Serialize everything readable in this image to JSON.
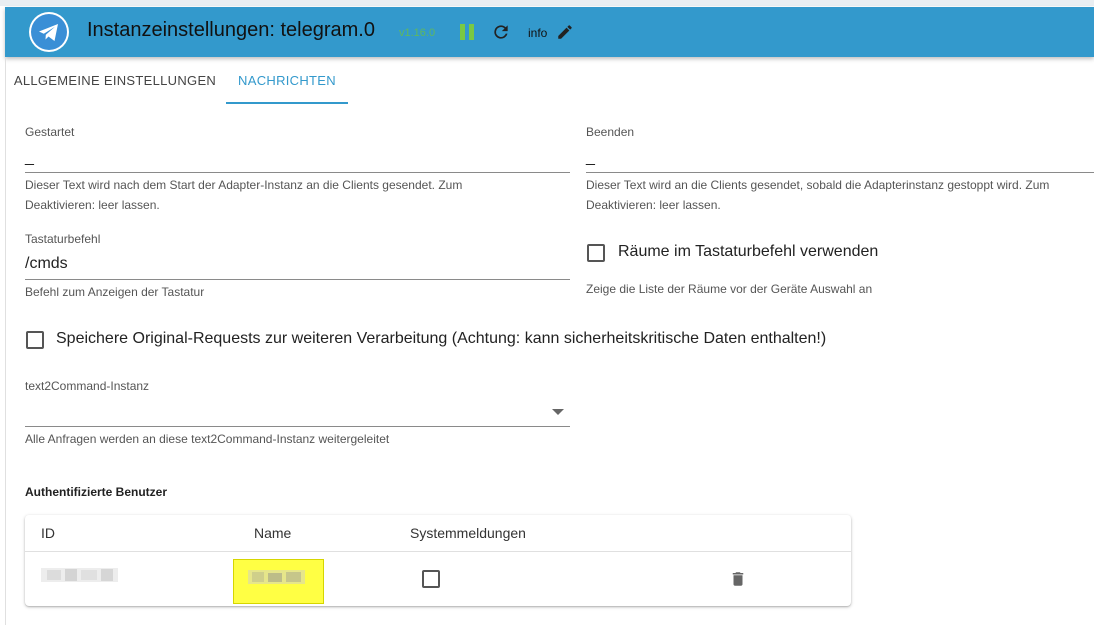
{
  "header": {
    "title": "Instanzeinstellungen: telegram.0",
    "version": "v1.16.0",
    "info_label": "info"
  },
  "tabs": [
    {
      "label": "ALLGEMEINE EINSTELLUNGEN",
      "active": false
    },
    {
      "label": "NACHRICHTEN",
      "active": true
    }
  ],
  "fields": {
    "started": {
      "label": "Gestartet",
      "value": "_",
      "helper_line1": "Dieser Text wird nach dem Start der Adapter-Instanz an die Clients gesendet. Zum",
      "helper_line2": "Deaktivieren: leer lassen."
    },
    "stopped": {
      "label": "Beenden",
      "value": "_",
      "helper_line1": "Dieser Text wird an die Clients gesendet, sobald die Adapterinstanz gestoppt wird. Zum",
      "helper_line2": "Deaktivieren: leer lassen."
    },
    "keyboard_command": {
      "label": "Tastaturbefehl",
      "value": "/cmds",
      "helper": "Befehl zum Anzeigen der Tastatur"
    },
    "rooms_in_keyboard": {
      "label": "Räume im Tastaturbefehl verwenden",
      "checked": false,
      "helper": "Zeige die Liste der Räume vor der Geräte Auswahl an"
    },
    "save_raw_requests": {
      "label": "Speichere Original-Requests zur weiteren Verarbeitung (Achtung: kann sicherheitskritische Daten enthalten!)",
      "checked": false
    },
    "text2command": {
      "label": "text2Command-Instanz",
      "value": "",
      "helper": "Alle Anfragen werden an diese text2Command-Instanz weitergeleitet"
    }
  },
  "users_section": {
    "title": "Authentifizierte Benutzer",
    "columns": [
      "ID",
      "Name",
      "Systemmeldungen"
    ],
    "rows": [
      {
        "system_messages": false
      }
    ]
  },
  "colors": {
    "header_bg": "#3399cc",
    "accent": "#3399cc",
    "version_green": "#5fb85f",
    "highlight": "#ffff44"
  },
  "icons": {
    "logo": "telegram-icon",
    "pause": "pause-icon",
    "refresh": "refresh-icon",
    "edit": "pencil-icon",
    "delete": "trash-icon",
    "dropdown": "chevron-down-icon"
  }
}
